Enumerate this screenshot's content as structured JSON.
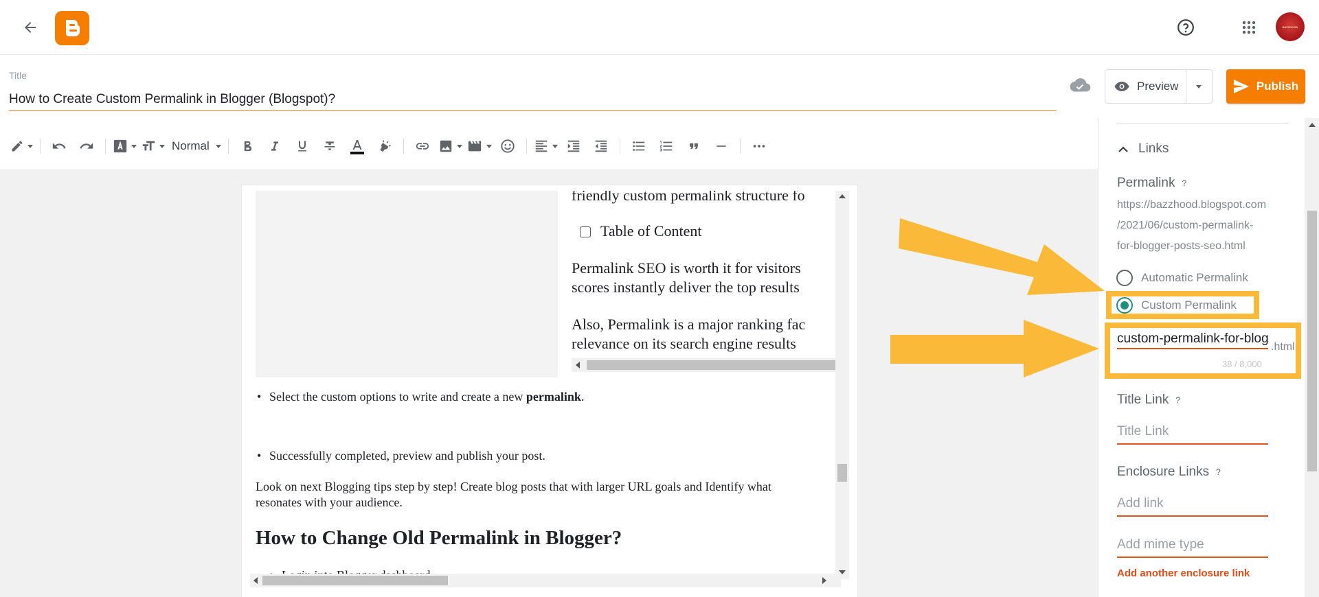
{
  "header": {
    "back_icon": "arrow-left-icon",
    "logo": "blogger-logo",
    "help_icon": "help-circle-icon",
    "apps_icon": "apps-grid-icon",
    "avatar_text": "BAZZHOOD"
  },
  "post": {
    "title_label": "Title",
    "title_value": "How to Create Custom Permalink in Blogger (Blogspot)?"
  },
  "actions": {
    "preview_label": "Preview",
    "publish_label": "Publish"
  },
  "toolbar": {
    "paragraph_style": "Normal",
    "icons": [
      "pencil-icon",
      "undo-icon",
      "redo-icon",
      "font-color-icon",
      "text-size-icon",
      "bold-icon",
      "italic-icon",
      "underline-icon",
      "strikethrough-icon",
      "text-color-icon",
      "highlight-icon",
      "link-icon",
      "image-icon",
      "video-icon",
      "emoji-icon",
      "align-icon",
      "indent-increase-icon",
      "indent-decrease-icon",
      "bulleted-list-icon",
      "numbered-list-icon",
      "quote-icon",
      "horizontal-rule-icon",
      "more-icon"
    ]
  },
  "content": {
    "embed_line1": "friendly custom permalink structure fo",
    "embed_toc": "Table of Content",
    "embed_line2": "Permalink SEO is worth it for visitors",
    "embed_line3": "scores instantly deliver the top results",
    "embed_line4": "Also, Permalink is a major ranking fac",
    "embed_line5": "relevance on its search engine results",
    "bullet1_text": "Select the custom options to write and create a new ",
    "bullet1_bold": "permalink",
    "bullet1_end": ".",
    "bullet2_text": "Successfully completed, preview and publish your post.",
    "paragraph": "Look on next Blogging tips step by step! Create blog posts that with larger URL goals and Identify what resonates with your audience.",
    "heading": "How to Change Old Permalink in Blogger?",
    "list_item": "Login into Blogger dashboard"
  },
  "sidebar": {
    "section_title": "Links",
    "permalink_label": "Permalink",
    "help_mark": "?",
    "permalink_url_line1": "https://bazzhood.blogspot.com",
    "permalink_url_line2": "/2021/06/custom-permalink-",
    "permalink_url_line3": "for-blogger-posts-seo.html",
    "option_automatic": "Automatic Permalink",
    "option_custom": "Custom Permalink",
    "selected_option": "Custom Permalink",
    "custom_value": "custom-permalink-for-blogger-posts-seo",
    "custom_suffix": ".html",
    "char_count": "38 / 8,000",
    "title_link_label": "Title Link",
    "title_link_placeholder": "Title Link",
    "enclosure_label": "Enclosure Links",
    "add_link_placeholder": "Add link",
    "mime_placeholder": "Add mime type",
    "add_enclosure": "Add another enclosure link"
  },
  "colors": {
    "brand_orange": "#f57d00",
    "annotation_yellow": "#fbb93a",
    "radio_teal": "#1e8e7e",
    "field_underline": "#e24c19"
  }
}
